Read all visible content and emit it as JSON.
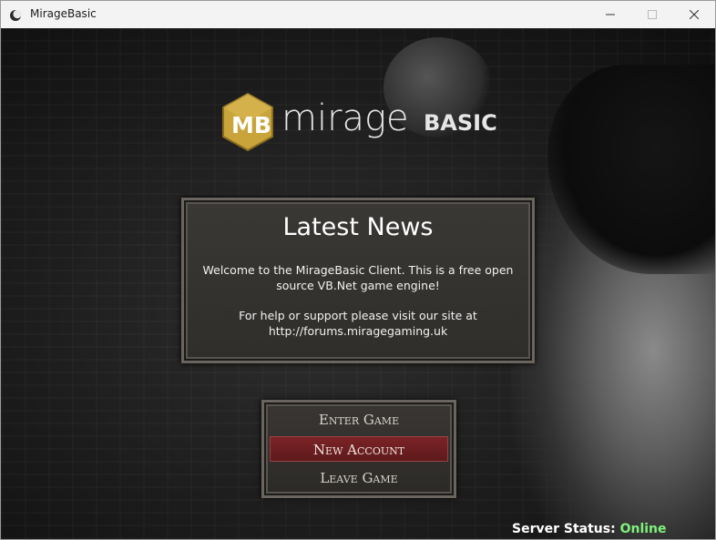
{
  "window": {
    "title": "MirageBasic",
    "app_icon": "moon-icon",
    "controls": {
      "minimize_icon": "minimize-icon",
      "maximize_icon": "maximize-icon",
      "close_icon": "close-icon"
    }
  },
  "logo": {
    "monogram": "MB",
    "word": "mirage",
    "suffix": "BASIC",
    "brand_color": "#c9a43a"
  },
  "news": {
    "title": "Latest News",
    "paragraph1": "Welcome to the MirageBasic Client. This is a free open source VB.Net game engine!",
    "paragraph2": "For help or support please visit our site at http://forums.miragegaming.uk"
  },
  "menu": {
    "items": [
      {
        "label": "Enter Game",
        "selected": false
      },
      {
        "label": "New Account",
        "selected": true
      },
      {
        "label": "Leave Game",
        "selected": false
      }
    ],
    "highlight_color": "#6e1f21"
  },
  "status": {
    "label": "Server Status:",
    "value": "Online",
    "value_color": "#7ef27a"
  }
}
